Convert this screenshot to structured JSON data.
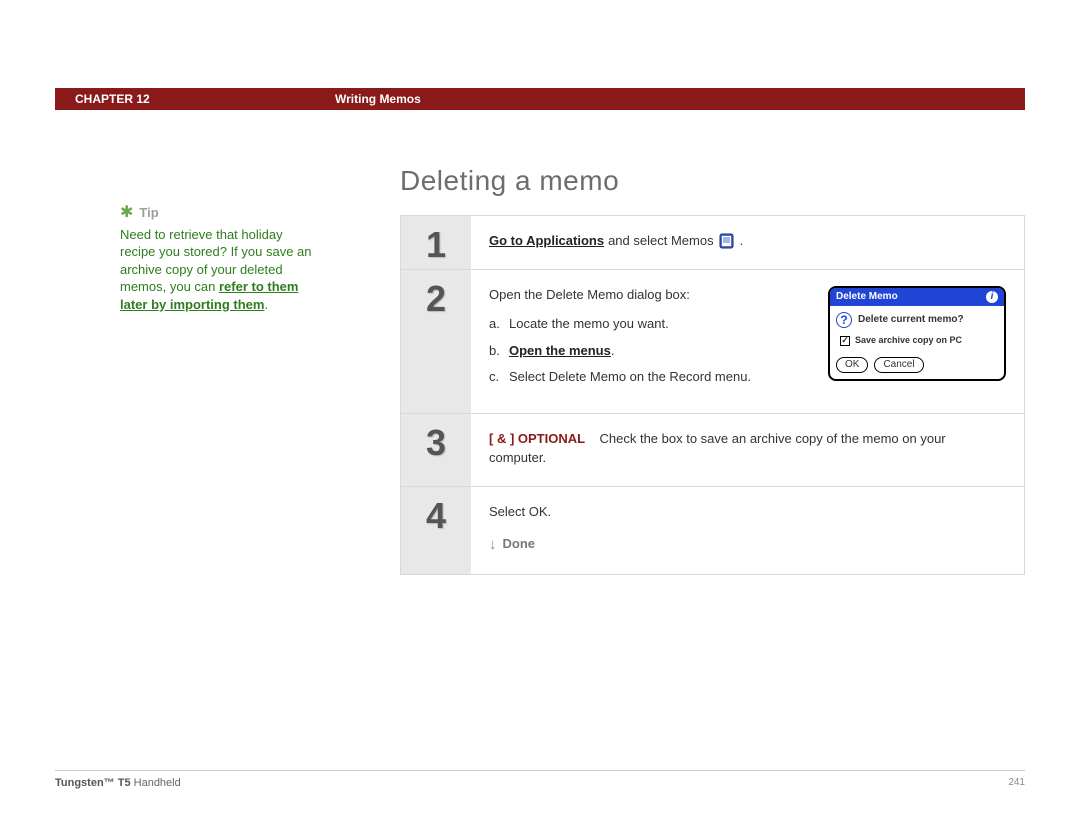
{
  "header": {
    "chapter": "CHAPTER 12",
    "section": "Writing Memos"
  },
  "sidebar": {
    "tip_label": "Tip",
    "tip_body_prefix": "Need to retrieve that holiday recipe you stored? If you save an archive copy of your deleted memos, you can ",
    "tip_link": "refer to them later by importing them",
    "tip_body_suffix": "."
  },
  "page_title": "Deleting a memo",
  "steps": {
    "s1": {
      "num": "1",
      "link": "Go to Applications",
      "rest": " and select Memos ",
      "period": "."
    },
    "s2": {
      "num": "2",
      "intro": "Open the Delete Memo dialog box:",
      "a_label": "a.",
      "a_text": "Locate the memo you want.",
      "b_label": "b.",
      "b_link": "Open the menus",
      "b_period": ".",
      "c_label": "c.",
      "c_text": "Select Delete Memo on the Record menu.",
      "dialog": {
        "title": "Delete Memo",
        "question": "Delete current memo?",
        "checkbox": "Save archive copy on PC",
        "ok": "OK",
        "cancel": "Cancel"
      }
    },
    "s3": {
      "num": "3",
      "optional_tag": "[ & ]  OPTIONAL",
      "text": "Check the box to save an archive copy of the memo on your computer."
    },
    "s4": {
      "num": "4",
      "text": "Select OK.",
      "done": "Done"
    }
  },
  "footer": {
    "product_bold": "Tungsten™ T5",
    "product_rest": " Handheld",
    "page": "241"
  }
}
